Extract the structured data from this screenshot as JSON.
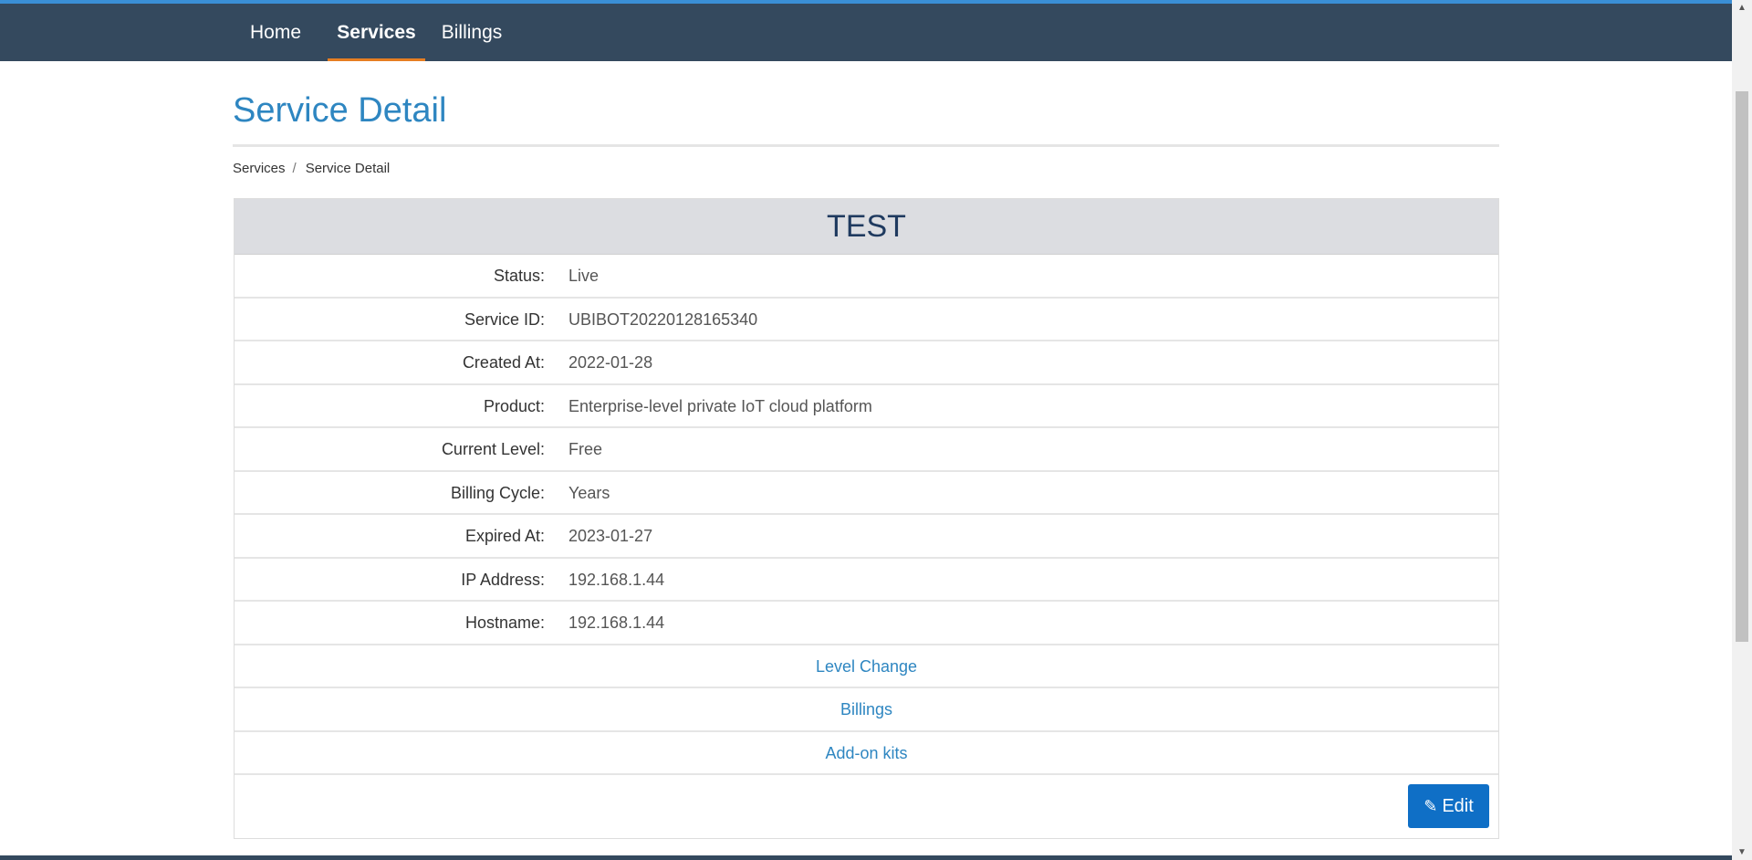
{
  "nav": {
    "home": "Home",
    "services": "Services",
    "billings": "Billings"
  },
  "page": {
    "title": "Service Detail"
  },
  "breadcrumb": {
    "services": "Services",
    "separator": "/",
    "current": "Service Detail"
  },
  "service": {
    "name": "TEST",
    "status_label": "Status:",
    "status_value": "Live",
    "service_id_label": "Service ID:",
    "service_id_value": "UBIBOT20220128165340",
    "created_label": "Created At:",
    "created_value": "2022-01-28",
    "product_label": "Product:",
    "product_value": "Enterprise-level private IoT cloud platform",
    "level_label": "Current Level:",
    "level_value": "Free",
    "cycle_label": "Billing Cycle:",
    "cycle_value": "Years",
    "expired_label": "Expired At:",
    "expired_value": "2023-01-27",
    "ip_label": "IP Address:",
    "ip_value": "192.168.1.44",
    "hostname_label": "Hostname:",
    "hostname_value": "192.168.1.44"
  },
  "links": {
    "level_change": "Level Change",
    "billings": "Billings",
    "addon_kits": "Add-on kits"
  },
  "actions": {
    "edit": "Edit"
  },
  "colors": {
    "navbar": "#34495e",
    "accent": "#2e86c1",
    "active_tab_underline": "#e67e22",
    "button": "#0f6fc6"
  },
  "icons": {
    "edit": "pencil-icon"
  }
}
